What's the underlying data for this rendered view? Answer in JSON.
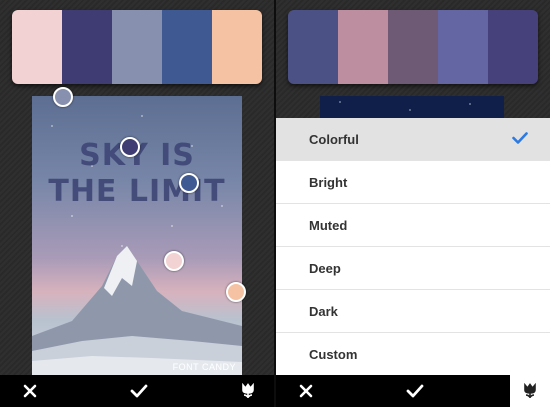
{
  "left_panel": {
    "palette": [
      "#f2d2d2",
      "#3e3c73",
      "#8790ae",
      "#3f5a93",
      "#f5c3a3"
    ],
    "poster": {
      "title_line1": "SKY IS",
      "title_line2": "THE LIMIT",
      "brand": "FONT CANDY"
    },
    "picker_colors": [
      "#8790ae",
      "#3e3c73",
      "#3f5a93",
      "#f2d2d2",
      "#f5c3a3"
    ]
  },
  "right_panel": {
    "palette": [
      "#4b5085",
      "#bd8e9f",
      "#6e5a75",
      "#6366a3",
      "#46417a"
    ],
    "menu": {
      "items": [
        {
          "label": "Colorful",
          "selected": true
        },
        {
          "label": "Bright",
          "selected": false
        },
        {
          "label": "Muted",
          "selected": false
        },
        {
          "label": "Deep",
          "selected": false
        },
        {
          "label": "Dark",
          "selected": false
        },
        {
          "label": "Custom",
          "selected": false
        }
      ],
      "check_color": "#2d7be0"
    }
  },
  "toolbar": {
    "icons": [
      "close-icon",
      "checkmark-icon",
      "tulip-icon"
    ]
  }
}
